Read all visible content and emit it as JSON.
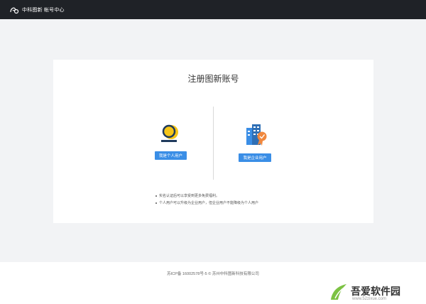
{
  "header": {
    "logo_text": "中科图新 帐号中心"
  },
  "card": {
    "title": "注册图新账号",
    "personal_button": "我是个人用户",
    "enterprise_button": "我是企业用户",
    "notes": [
      "实名认证后可以享受到更多免费福利。",
      "个人用户可以升级为企业用户，但企业用户不能降级为个人用户"
    ]
  },
  "footer": {
    "copyright": "苏ICP备 16002578号-5 © 苏州中科图新科技有限公司"
  },
  "watermark": {
    "brand_name": "吾爱软件园",
    "site": "www.52zixue.com"
  },
  "colors": {
    "topbar": "#1f2227",
    "accent": "#3a8ee6",
    "icon_yellow": "#f5c518",
    "icon_navy": "#1f3a5c"
  }
}
